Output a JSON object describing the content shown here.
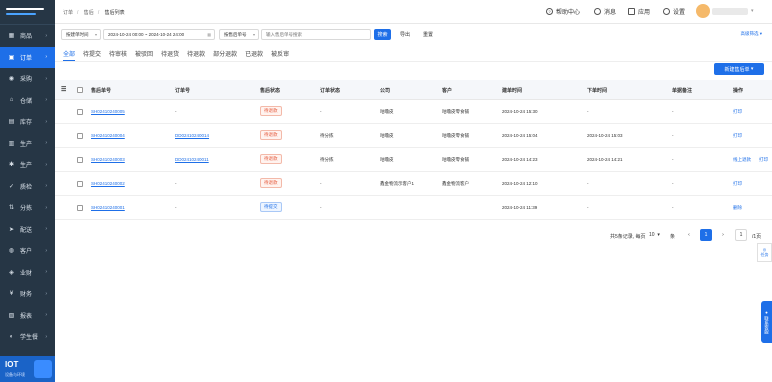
{
  "sidebar": {
    "items": [
      {
        "label": "商品",
        "icon": "grid-icon"
      },
      {
        "label": "订单",
        "icon": "cart-icon",
        "active": true
      },
      {
        "label": "采购",
        "icon": "truck-icon"
      },
      {
        "label": "仓储",
        "icon": "warehouse-icon"
      },
      {
        "label": "库存",
        "icon": "box-icon"
      },
      {
        "label": "生产",
        "icon": "factory-icon"
      },
      {
        "label": "生产",
        "icon": "gear-icon"
      },
      {
        "label": "质检",
        "icon": "check-icon"
      },
      {
        "label": "分拣",
        "icon": "sort-icon"
      },
      {
        "label": "配送",
        "icon": "delivery-icon"
      },
      {
        "label": "客户",
        "icon": "user-icon"
      },
      {
        "label": "业财",
        "icon": "finance-icon"
      },
      {
        "label": "财务",
        "icon": "money-icon"
      },
      {
        "label": "报表",
        "icon": "report-icon"
      },
      {
        "label": "学生餐",
        "icon": "meal-icon"
      }
    ],
    "iot": {
      "title": "IOT",
      "subtitle": "设备与环境"
    }
  },
  "header": {
    "breadcrumb": [
      "订单",
      "售后",
      "售后列表"
    ],
    "help": "帮助中心",
    "messages": "消息",
    "apps": "应用",
    "settings": "设置"
  },
  "filters": {
    "time_type": "按建单时间",
    "date_range": "2024-10-24 00:00 ~ 2024-10-24 24:00",
    "search_type": "按售后单号",
    "search_placeholder": "输入售后单号搜索",
    "search_btn": "搜索",
    "export_btn": "导出",
    "reset_btn": "重置",
    "advanced": "高级筛选"
  },
  "tabs": [
    "全部",
    "待提交",
    "待审核",
    "被驳回",
    "待退货",
    "待退款",
    "部分退款",
    "已退款",
    "被反审"
  ],
  "new_button": "新建售后单",
  "table": {
    "headers": [
      "售后单号",
      "订单号",
      "售后状态",
      "订单状态",
      "公司",
      "客户",
      "建单时间",
      "下单时间",
      "单据备注",
      "操作"
    ],
    "rows": [
      {
        "id": "SH02410240005",
        "order": "-",
        "status": "待退款",
        "status_color": "red",
        "order_status": "-",
        "company": "咕噜皮",
        "customer": "咕噜皮零食铺",
        "created": "2024-10-24 15:30",
        "ordered": "-",
        "remark": "-",
        "ops": [
          "打印"
        ]
      },
      {
        "id": "SH02410240004",
        "order": "DD02410240014",
        "status": "待退款",
        "status_color": "red",
        "order_status": "待分拣",
        "company": "咕噜皮",
        "customer": "咕噜皮零食铺",
        "created": "2024-10-24 15:04",
        "ordered": "2024-10-24 15:03",
        "remark": "-",
        "ops": [
          "打印"
        ]
      },
      {
        "id": "SH02410240003",
        "order": "DD02410240011",
        "status": "待退款",
        "status_color": "red",
        "order_status": "待分拣",
        "company": "咕噜皮",
        "customer": "咕噜皮零食铺",
        "created": "2024-10-24 14:23",
        "ordered": "2024-10-24 14:21",
        "remark": "-",
        "ops": [
          "线上退款",
          "打印"
        ]
      },
      {
        "id": "SH02410240002",
        "order": "-",
        "status": "待退款",
        "status_color": "red",
        "order_status": "-",
        "company": "鑫金物流示客户1",
        "customer": "鑫金物流客户",
        "created": "2024-10-24 12:10",
        "ordered": "-",
        "remark": "-",
        "ops": [
          "打印"
        ]
      },
      {
        "id": "SH02410240001",
        "order": "-",
        "status": "待提交",
        "status_color": "blue",
        "order_status": "-",
        "company": "",
        "customer": "",
        "created": "2024-10-24 11:39",
        "ordered": "-",
        "remark": "-",
        "ops": [
          "删除"
        ]
      }
    ]
  },
  "pagination": {
    "summary": "共5条记录, 每页",
    "page_size": "10",
    "unit": "条",
    "current": "1",
    "goto": "1",
    "pages_label": "/1页"
  },
  "float": {
    "task": "任务",
    "service": "联系客服"
  }
}
